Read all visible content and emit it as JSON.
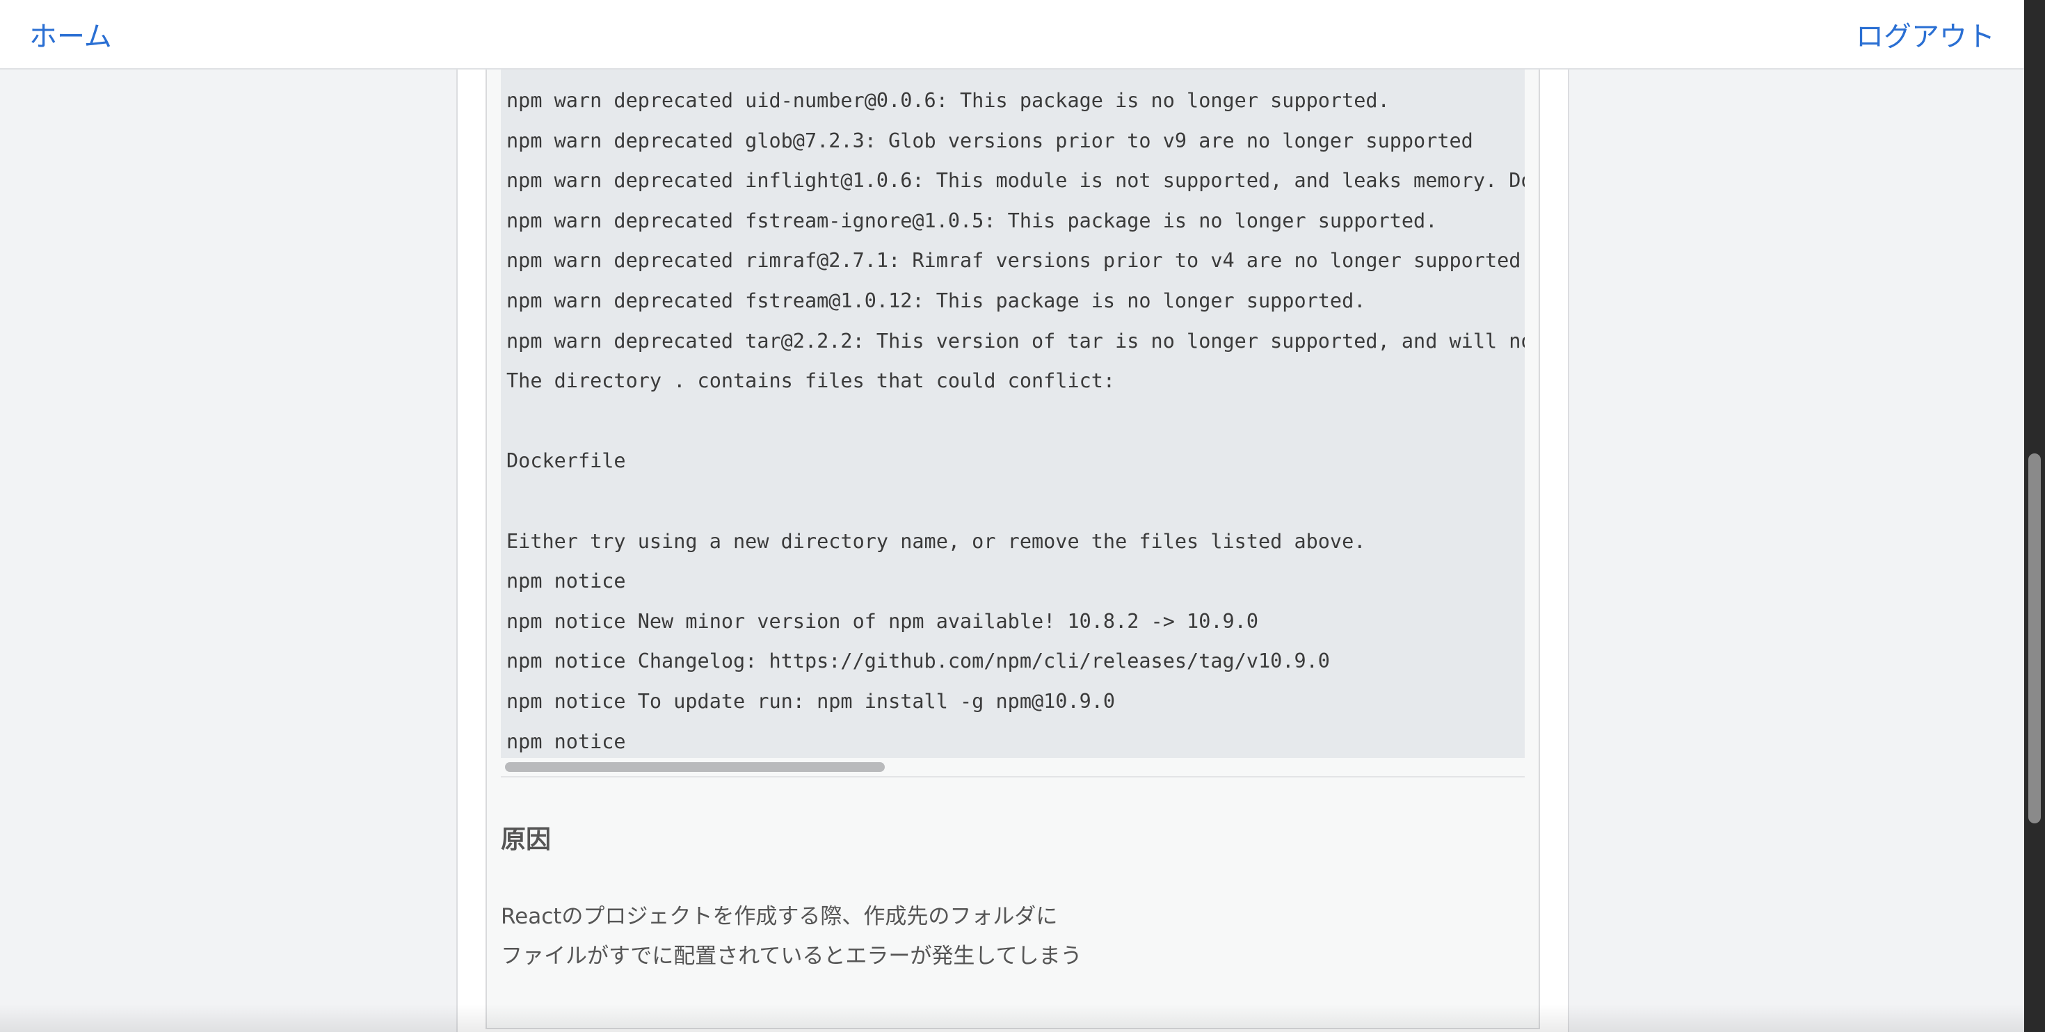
{
  "header": {
    "home_label": "ホーム",
    "logout_label": "ログアウト"
  },
  "code_block": {
    "lines": [
      "npm warn deprecated uid-number@0.0.6: This package is no longer supported.",
      "npm warn deprecated glob@7.2.3: Glob versions prior to v9 are no longer supported",
      "npm warn deprecated inflight@1.0.6: This module is not supported, and leaks memory. Do not u",
      "npm warn deprecated fstream-ignore@1.0.5: This package is no longer supported.",
      "npm warn deprecated rimraf@2.7.1: Rimraf versions prior to v4 are no longer supported",
      "npm warn deprecated fstream@1.0.12: This package is no longer supported.",
      "npm warn deprecated tar@2.2.2: This version of tar is no longer supported, and will not rece",
      "The directory . contains files that could conflict:",
      "",
      "Dockerfile",
      "",
      "Either try using a new directory name, or remove the files listed above.",
      "npm notice",
      "npm notice New minor version of npm available! 10.8.2 -> 10.9.0",
      "npm notice Changelog: https://github.com/npm/cli/releases/tag/v10.9.0",
      "npm notice To update run: npm install -g npm@10.9.0",
      "npm notice"
    ]
  },
  "section": {
    "title": "原因",
    "paragraph_lines": [
      "Reactのプロジェクトを作成する際、作成先のフォルダに",
      "ファイルがすでに配置されているとエラーが発生してしまう"
    ]
  },
  "colors": {
    "link": "#2a6fd3",
    "code_background": "#e6e9ec",
    "page_background": "#f2f3f5"
  }
}
